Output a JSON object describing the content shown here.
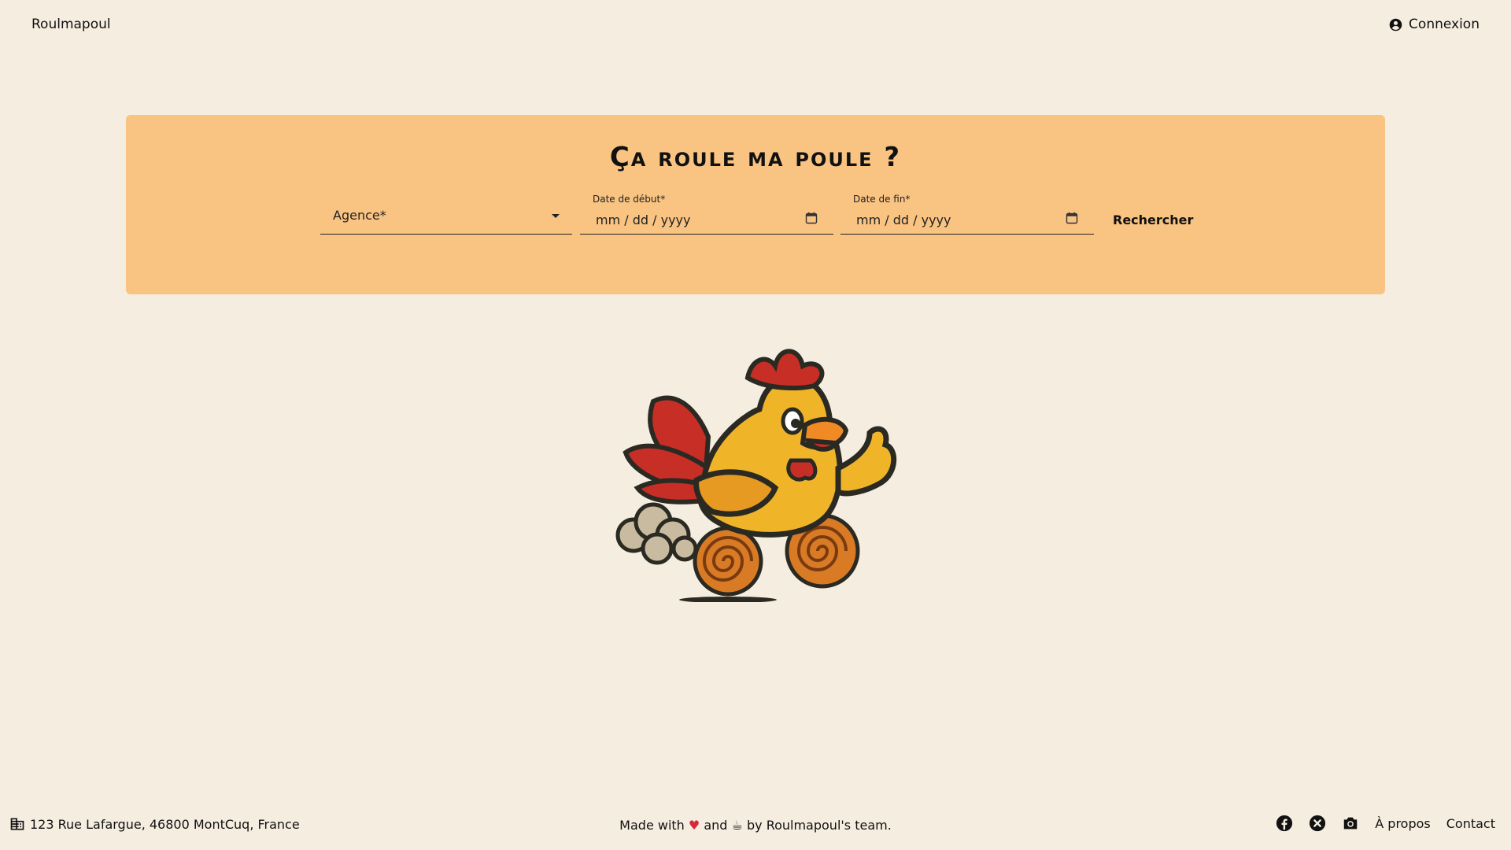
{
  "header": {
    "brand": "Roulmapoul",
    "login_label": "Connexion"
  },
  "search": {
    "title": "Ça roule ma poule ?",
    "agence_label": "Agence*",
    "date_debut_label": "Date de début*",
    "date_debut_value": "mm / dd / yyyy",
    "date_fin_label": "Date de fin*",
    "date_fin_value": "mm / dd / yyyy",
    "submit_label": "Rechercher"
  },
  "footer": {
    "address": "123 Rue Lafargue, 46800 MontCuq, France",
    "made_prefix": "Made with",
    "made_and": "and",
    "made_suffix": "by Roulmapoul's team.",
    "heart_glyph": "♥",
    "coffee_glyph": "☕",
    "about_label": "À propos",
    "contact_label": "Contact"
  },
  "colors": {
    "background": "#f5ede0",
    "panel": "#f9c382",
    "accent_heart": "#d8293a"
  },
  "icons": [
    "account-circle-icon",
    "chevron-down-icon",
    "calendar-icon",
    "building-icon",
    "facebook-icon",
    "x-icon",
    "camera-icon"
  ]
}
